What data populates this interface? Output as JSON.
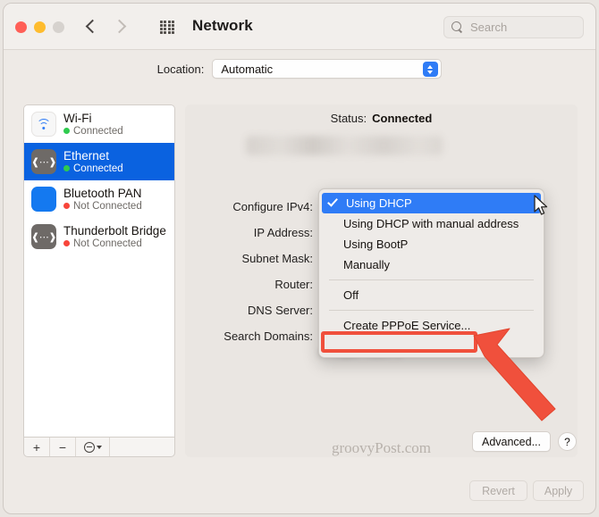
{
  "window": {
    "title": "Network",
    "traffic_lights": [
      "close",
      "minimize",
      "zoom-disabled"
    ],
    "nav": {
      "back": "back-chevron",
      "forward": "forward-chevron"
    },
    "grid_icon": "all-preferences-grid-icon"
  },
  "search": {
    "placeholder": "Search",
    "icon": "search-icon"
  },
  "location": {
    "label": "Location:",
    "value": "Automatic",
    "options": [
      "Automatic"
    ]
  },
  "sidebar": {
    "services": [
      {
        "name": "Wi-Fi",
        "status": "Connected",
        "status_color": "#2fcb4f",
        "icon": "wifi-icon",
        "selected": false
      },
      {
        "name": "Ethernet",
        "status": "Connected",
        "status_color": "#2fcb4f",
        "icon": "ethernet-icon",
        "selected": true
      },
      {
        "name": "Bluetooth PAN",
        "status": "Not Connected",
        "status_color": "#f8453a",
        "icon": "bluetooth-icon",
        "selected": false
      },
      {
        "name": "Thunderbolt Bridge",
        "status": "Not Connected",
        "status_color": "#f8453a",
        "icon": "ethernet-icon",
        "selected": false
      }
    ],
    "footer": {
      "add": "+",
      "remove": "−",
      "options": "options-menu-icon"
    }
  },
  "detail": {
    "status_label": "Status:",
    "status_value": "Connected",
    "status_detail_redacted": true,
    "fields": [
      {
        "label": "Configure IPv4:"
      },
      {
        "label": "IP Address:"
      },
      {
        "label": "Subnet Mask:"
      },
      {
        "label": "Router:"
      },
      {
        "label": "DNS Server:"
      },
      {
        "label": "Search Domains:"
      }
    ]
  },
  "popup_menu": {
    "open": true,
    "anchor_field": "Configure IPv4:",
    "items": [
      {
        "label": "Using DHCP",
        "checked": true,
        "separator_after": false
      },
      {
        "label": "Using DHCP with manual address",
        "checked": false,
        "separator_after": false
      },
      {
        "label": "Using BootP",
        "checked": false,
        "separator_after": false
      },
      {
        "label": "Manually",
        "checked": false,
        "separator_after": true
      },
      {
        "label": "Off",
        "checked": false,
        "separator_after": true
      },
      {
        "label": "Create PPPoE Service...",
        "checked": false,
        "separator_after": false,
        "highlighted": true
      }
    ]
  },
  "annotations": {
    "callout_color": "#f0503c",
    "callout_target": "Create PPPoE Service...",
    "arrow": "red-pointer-arrow"
  },
  "watermark": "groovyPost.com",
  "buttons": {
    "advanced": "Advanced...",
    "help": "?",
    "revert": "Revert",
    "apply": "Apply"
  }
}
